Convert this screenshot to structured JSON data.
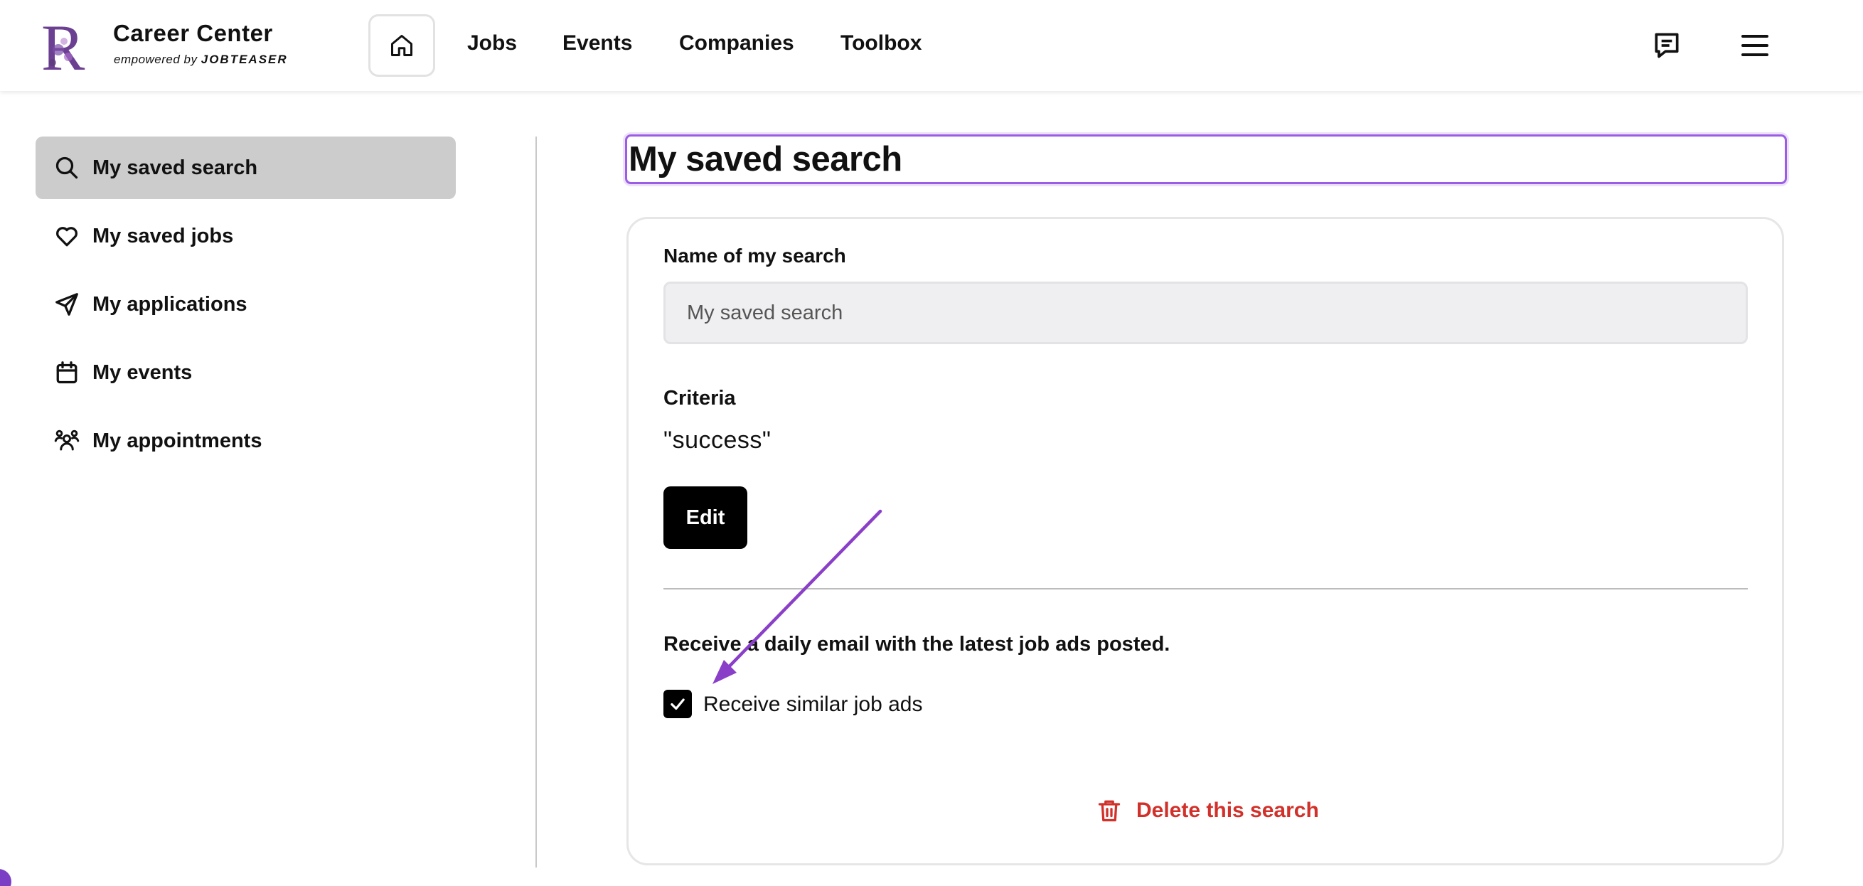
{
  "header": {
    "logo_letter": "R",
    "logo_title": "Career Center",
    "logo_subtitle_prefix": "empowered by",
    "logo_subtitle_brand": "JOBTEASER",
    "nav": {
      "home_icon": "home-icon",
      "jobs": "Jobs",
      "events": "Events",
      "companies": "Companies",
      "toolbox": "Toolbox"
    },
    "chat_icon": "chat-icon",
    "menu_icon": "hamburger-menu-icon"
  },
  "sidebar": {
    "items": [
      {
        "label": "My saved search",
        "icon": "search-icon",
        "active": true
      },
      {
        "label": "My saved jobs",
        "icon": "heart-icon",
        "active": false
      },
      {
        "label": "My applications",
        "icon": "send-icon",
        "active": false
      },
      {
        "label": "My events",
        "icon": "calendar-icon",
        "active": false
      },
      {
        "label": "My appointments",
        "icon": "people-icon",
        "active": false
      }
    ]
  },
  "main": {
    "title": "My saved search",
    "name_label": "Name of my search",
    "name_value": "My saved search",
    "criteria_label": "Criteria",
    "criteria_value": "\"success\"",
    "edit_label": "Edit",
    "email_text": "Receive a daily email with the latest job ads posted.",
    "checkbox_label": "Receive similar job ads",
    "checkbox_checked": true,
    "delete_label": "Delete this search"
  },
  "colors": {
    "accent_purple": "#9b5de5",
    "annotation_arrow": "#8a3fc8",
    "danger_red": "#d1312a",
    "active_sidebar_bg": "#cccccc"
  }
}
